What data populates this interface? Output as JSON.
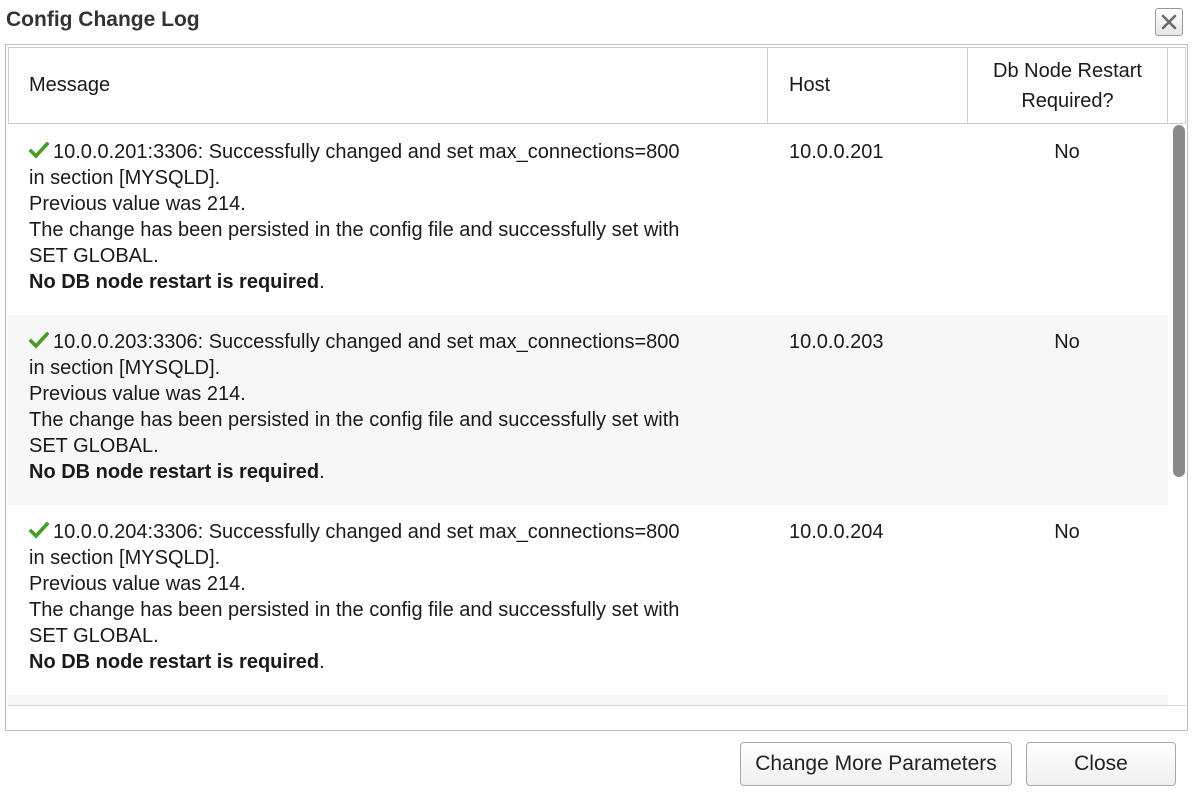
{
  "dialog": {
    "title": "Config Change Log",
    "close_icon": "close-icon"
  },
  "table": {
    "columns": {
      "message": "Message",
      "host": "Host",
      "restart_line1": "Db Node Restart",
      "restart_line2": "Required?"
    },
    "rows": [
      {
        "status_icon": "checkmark-icon",
        "line1": "10.0.0.201:3306: Successfully changed and set max_connections=800",
        "line2": "in section [MYSQLD].",
        "line3": "Previous value was 214.",
        "line4": "The change has been persisted in the config file and successfully set with",
        "line5": "SET GLOBAL.",
        "line6_bold": "No DB node restart is required",
        "line6_tail": ".",
        "host": "10.0.0.201",
        "restart": "No"
      },
      {
        "status_icon": "checkmark-icon",
        "line1": "10.0.0.203:3306: Successfully changed and set max_connections=800",
        "line2": "in section [MYSQLD].",
        "line3": "Previous value was 214.",
        "line4": "The change has been persisted in the config file and successfully set with",
        "line5": "SET GLOBAL.",
        "line6_bold": "No DB node restart is required",
        "line6_tail": ".",
        "host": "10.0.0.203",
        "restart": "No"
      },
      {
        "status_icon": "checkmark-icon",
        "line1": "10.0.0.204:3306: Successfully changed and set max_connections=800",
        "line2": "in section [MYSQLD].",
        "line3": "Previous value was 214.",
        "line4": "The change has been persisted in the config file and successfully set with",
        "line5": "SET GLOBAL.",
        "line6_bold": "No DB node restart is required",
        "line6_tail": ".",
        "host": "10.0.0.204",
        "restart": "No"
      }
    ]
  },
  "buttons": {
    "change_more": "Change More Parameters",
    "close": "Close"
  },
  "colors": {
    "check": "#4a9a2a"
  }
}
